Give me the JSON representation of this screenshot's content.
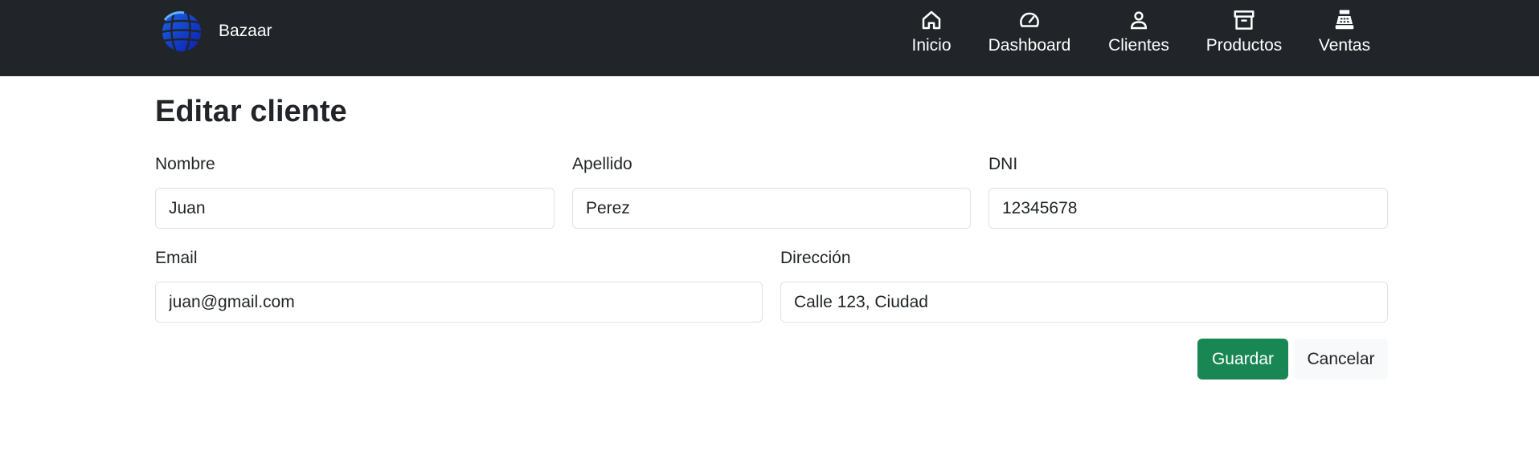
{
  "navbar": {
    "brand": {
      "name": "Bazaar",
      "logo_icon": "globe-logo-icon"
    },
    "items": [
      {
        "label": "Inicio",
        "icon": "home-icon"
      },
      {
        "label": "Dashboard",
        "icon": "speedometer-icon"
      },
      {
        "label": "Clientes",
        "icon": "person-icon"
      },
      {
        "label": "Productos",
        "icon": "archive-box-icon"
      },
      {
        "label": "Ventas",
        "icon": "cash-register-icon"
      }
    ],
    "colors": {
      "background": "#212529",
      "text": "#ffffff"
    }
  },
  "page": {
    "title": "Editar cliente",
    "form": {
      "nombre": {
        "label": "Nombre",
        "value": "Juan"
      },
      "apellido": {
        "label": "Apellido",
        "value": "Perez"
      },
      "dni": {
        "label": "DNI",
        "value": "12345678"
      },
      "email": {
        "label": "Email",
        "value": "juan@gmail.com"
      },
      "direccion": {
        "label": "Dirección",
        "value": "Calle 123, Ciudad"
      }
    },
    "actions": {
      "save_label": "Guardar",
      "cancel_label": "Cancelar"
    },
    "colors": {
      "save_button": "#198754",
      "cancel_button": "#f8f9fa"
    }
  }
}
